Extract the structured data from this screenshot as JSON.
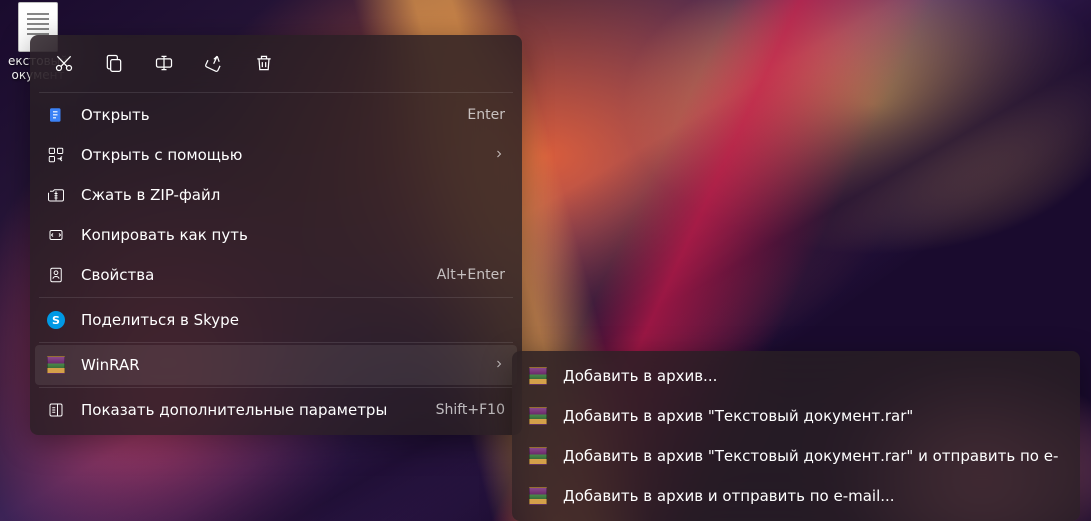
{
  "desktop": {
    "file_label": "екстовый окумент"
  },
  "menu": {
    "open": {
      "label": "Открыть",
      "shortcut": "Enter"
    },
    "open_with": {
      "label": "Открыть с помощью"
    },
    "compress_zip": {
      "label": "Сжать в ZIP-файл"
    },
    "copy_path": {
      "label": "Копировать как путь"
    },
    "properties": {
      "label": "Свойства",
      "shortcut": "Alt+Enter"
    },
    "skype_share": {
      "label": "Поделиться в Skype"
    },
    "winrar": {
      "label": "WinRAR"
    },
    "more_options": {
      "label": "Показать дополнительные параметры",
      "shortcut": "Shift+F10"
    }
  },
  "submenu": {
    "add_archive": "Добавить в архив...",
    "add_named": "Добавить в архив \"Текстовый документ.rar\"",
    "add_email_named": "Добавить в архив \"Текстовый документ.rar\" и отправить по e-",
    "add_email": "Добавить в архив и отправить по e-mail..."
  }
}
